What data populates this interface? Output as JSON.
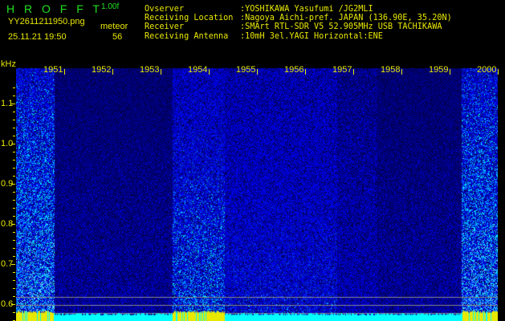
{
  "app": {
    "title": "H R O F F T",
    "version": "1.00f"
  },
  "file": {
    "name": "YY2611211950.png",
    "datetime": "25.11.21 19:50"
  },
  "meteor": {
    "label": "meteor",
    "count": "56"
  },
  "info": [
    {
      "label": "Ovserver",
      "value": ":YOSHIKAWA Yasufumi /JG2MLI"
    },
    {
      "label": "Receiving Location",
      "value": ":Nagoya Aichi-pref. JAPAN (136.90E, 35.20N)"
    },
    {
      "label": "Receiver",
      "value": ":SMArt RTL-SDR V5 52.905MHz USB TACHIKAWA"
    },
    {
      "label": "Receiving Antenna",
      "value": ":10mH 3el.YAGI Horizontal:ENE"
    }
  ],
  "axis": {
    "y_unit": "kHz",
    "y_labels": [
      "1.1",
      "1.0",
      "0.9",
      "0.8",
      "0.7",
      "0.6"
    ],
    "x_labels": [
      "1951",
      "1952",
      "1953",
      "1954",
      "1955",
      "1956",
      "1957",
      "1958",
      "1959",
      "2000"
    ]
  },
  "colors": {
    "text": "#e8e800",
    "title": "#22e022",
    "signal_bar": "#e8e800",
    "noise_bar": "#00ffff",
    "reference_lines": "#888888"
  }
}
